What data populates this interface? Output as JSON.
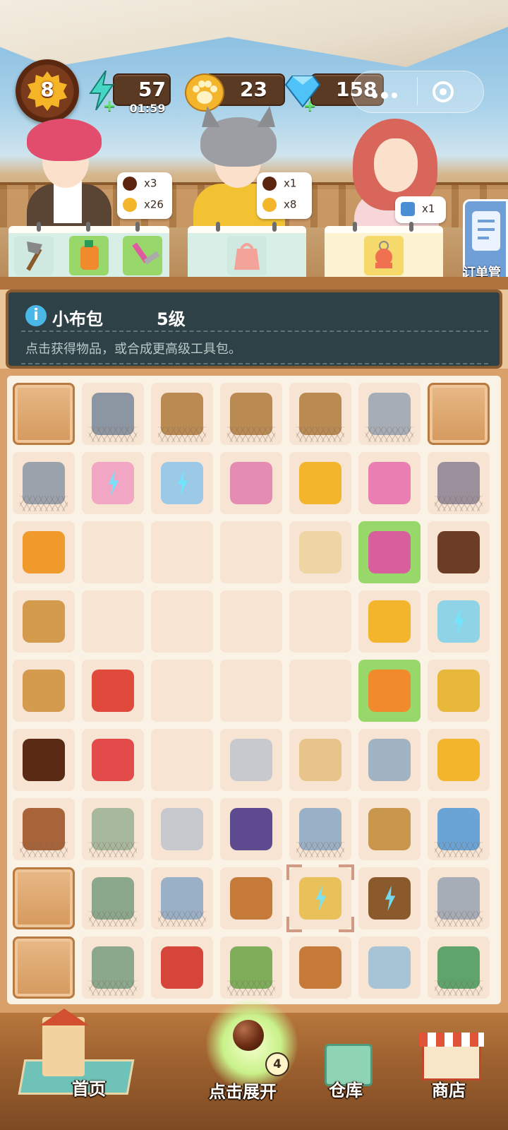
{
  "hud": {
    "player_level": "8",
    "energy": "57",
    "energy_timer": "01:59",
    "paws": "23",
    "gems": "158"
  },
  "colors": {
    "energy": "#45d6c5",
    "paw": "#f3b52c",
    "gem": "#4fc3f7",
    "accent_green": "#98d86a",
    "panel": "#2e4146"
  },
  "customers": [
    {
      "name": "male-customer",
      "requirements": [
        {
          "icon": "coffee-bean-icon",
          "qty": "x3"
        },
        {
          "icon": "paw-icon",
          "qty": "x26"
        }
      ]
    },
    {
      "name": "cat-girl-customer",
      "requirements": [
        {
          "icon": "coffee-bean-icon",
          "qty": "x1"
        },
        {
          "icon": "paw-icon",
          "qty": "x8"
        }
      ]
    },
    {
      "name": "red-hair-customer",
      "requirements": [
        {
          "icon": "cube-icon",
          "qty": "x1"
        }
      ]
    }
  ],
  "orders_label": "订单管",
  "info": {
    "title": "小布包",
    "level": "5级",
    "description": "点击获得物品，或合成更高级工具包。"
  },
  "nav": {
    "home": "首页",
    "expand": "点击展开",
    "expand_count": "4",
    "warehouse": "仓库",
    "shop": "商店"
  }
}
